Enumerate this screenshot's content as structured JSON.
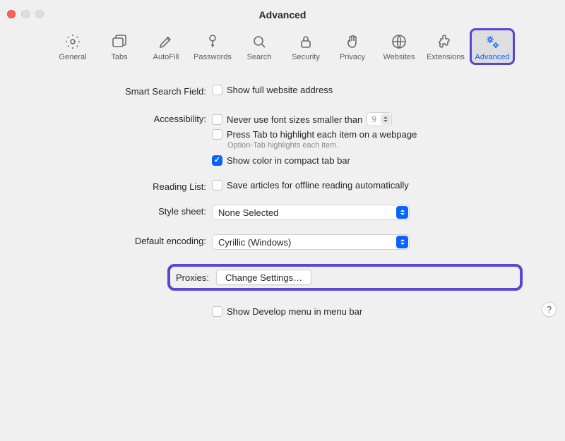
{
  "window": {
    "title": "Advanced"
  },
  "toolbar": {
    "items": [
      {
        "label": "General"
      },
      {
        "label": "Tabs"
      },
      {
        "label": "AutoFill"
      },
      {
        "label": "Passwords"
      },
      {
        "label": "Search"
      },
      {
        "label": "Security"
      },
      {
        "label": "Privacy"
      },
      {
        "label": "Websites"
      },
      {
        "label": "Extensions"
      },
      {
        "label": "Advanced"
      }
    ]
  },
  "labels": {
    "smart_search": "Smart Search Field:",
    "accessibility": "Accessibility:",
    "reading_list": "Reading List:",
    "style_sheet": "Style sheet:",
    "default_encoding": "Default encoding:",
    "proxies": "Proxies:"
  },
  "options": {
    "show_full_url": "Show full website address",
    "never_font_smaller": "Never use font sizes smaller than",
    "font_size_value": "9",
    "press_tab": "Press Tab to highlight each item on a webpage",
    "option_tab_hint": "Option-Tab highlights each item.",
    "show_color_compact": "Show color in compact tab bar",
    "save_offline": "Save articles for offline reading automatically",
    "style_sheet_value": "None Selected",
    "default_encoding_value": "Cyrillic (Windows)",
    "change_settings": "Change Settings…",
    "show_develop": "Show Develop menu in menu bar"
  },
  "help_glyph": "?"
}
